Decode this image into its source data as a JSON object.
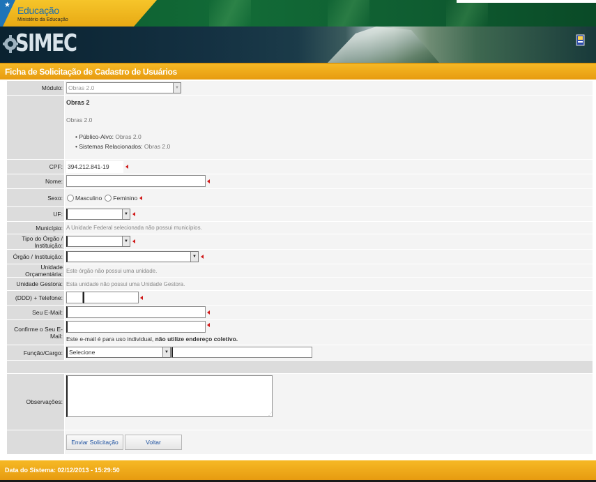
{
  "brand": {
    "ministry_title": "Educação",
    "ministry_subtitle": "Ministério da Educação",
    "system_name": "SIMEC"
  },
  "page": {
    "title": "Ficha de Solicitação de Cadastro de Usuários"
  },
  "form": {
    "modulo": {
      "label": "Módulo:",
      "value": "Obras 2.0"
    },
    "modulo_info": {
      "heading": "Obras 2",
      "description": "Obras 2.0",
      "publico_label": "Público-Alvo:",
      "publico_value": "Obras 2.0",
      "sistemas_label": "Sistemas Relacionados:",
      "sistemas_value": "Obras 2.0"
    },
    "cpf": {
      "label": "CPF:",
      "value": "394.212.841-19"
    },
    "nome": {
      "label": "Nome:",
      "value": ""
    },
    "sexo": {
      "label": "Sexo:",
      "masculino": "Masculino",
      "feminino": "Feminino"
    },
    "uf": {
      "label": "UF:",
      "value": ""
    },
    "municipio": {
      "label": "Município:",
      "message": "A Unidade Federal selecionada não possui municípios."
    },
    "tipo_orgao": {
      "label": "Tipo do Órgão / Instituição:",
      "value": ""
    },
    "orgao": {
      "label": "Órgão / Instituição:",
      "value": ""
    },
    "unidade_orcamentaria": {
      "label": "Unidade Orçamentária:",
      "message": "Este órgão não possui uma unidade."
    },
    "unidade_gestora": {
      "label": "Unidade Gestora:",
      "message": "Esta unidade não possui uma Unidade Gestora."
    },
    "telefone": {
      "label": "(DDD) + Telefone:",
      "ddd": "",
      "numero": ""
    },
    "email": {
      "label": "Seu E-Mail:",
      "value": ""
    },
    "confirm_email": {
      "label": "Confirme o Seu E-Mail:",
      "value": "",
      "note_prefix": "Este e-mail é para uso individual,",
      "note_bold": "não utilize endereço coletivo."
    },
    "funcao": {
      "label": "Função/Cargo:",
      "selected": "Selecione",
      "other": ""
    },
    "observacoes": {
      "label": "Observações:",
      "value": ""
    },
    "buttons": {
      "submit": "Enviar Solicitação",
      "back": "Voltar"
    }
  },
  "footer": {
    "system_date": "Data do Sistema: 02/12/2013 - 15:29:50"
  },
  "colors": {
    "header_orange": "#e79b10",
    "label_gray": "#dcdcdc",
    "required_red": "#d01818",
    "link_blue": "#1b4f9e"
  }
}
